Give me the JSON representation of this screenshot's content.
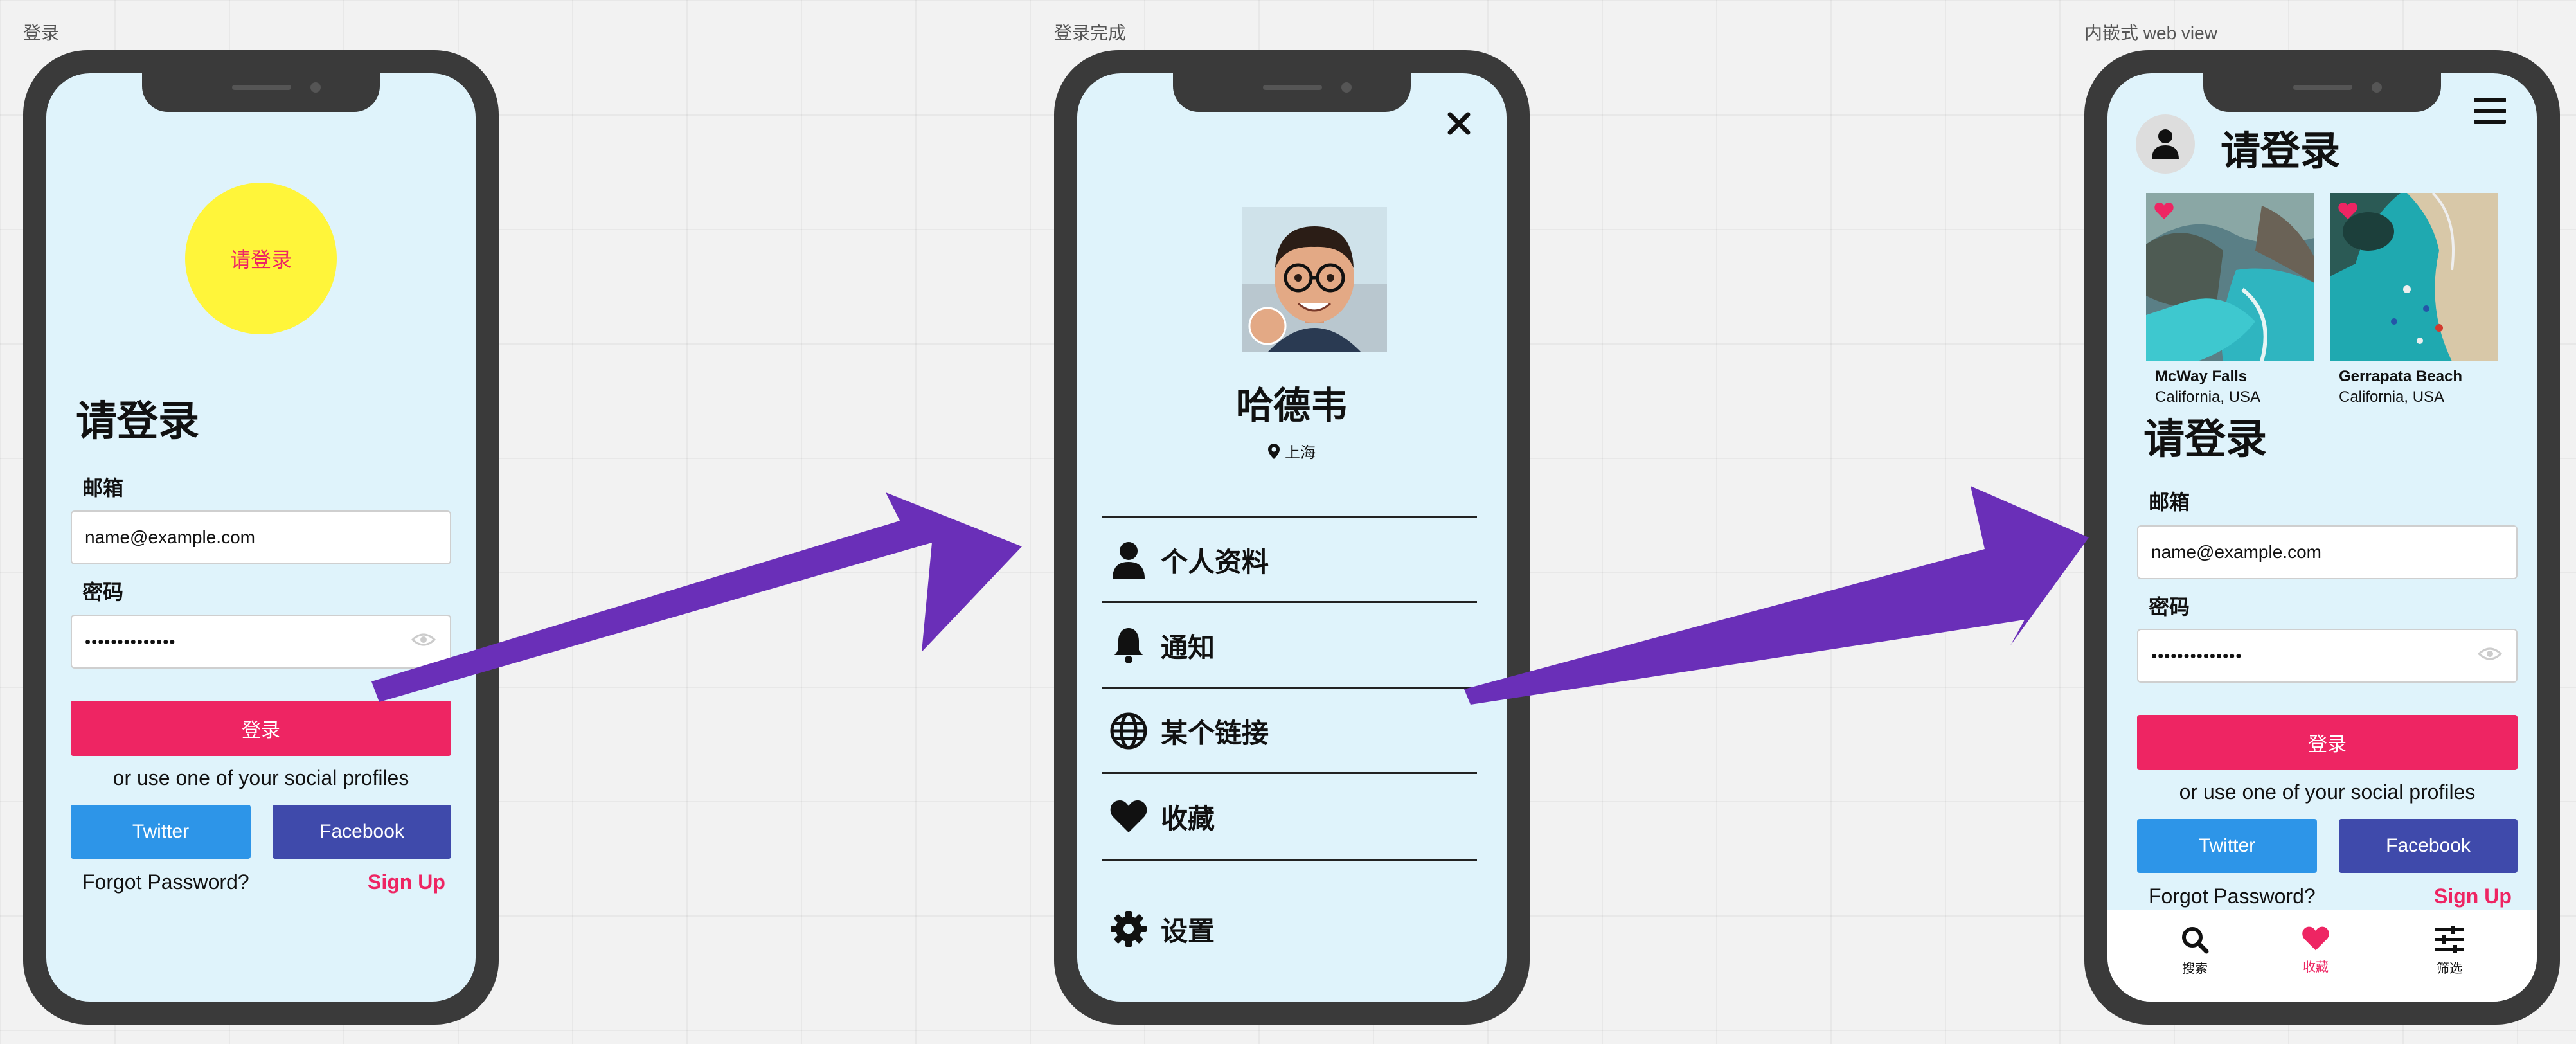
{
  "frames": [
    {
      "label": "登录"
    },
    {
      "label": "登录完成"
    },
    {
      "label": "内嵌式 web view"
    }
  ],
  "login": {
    "avatar_text": "请登录",
    "heading": "请登录",
    "email_label": "邮箱",
    "email_value": "name@example.com",
    "password_label": "密码",
    "password_value": "••••••••••••••",
    "login_button": "登录",
    "social_text": "or use one of your social profiles",
    "twitter": "Twitter",
    "facebook": "Facebook",
    "forgot": "Forgot Password?",
    "signup": "Sign Up"
  },
  "profile": {
    "name": "哈德韦",
    "location": "上海",
    "menu": [
      {
        "label": "个人资料",
        "icon": "user-icon"
      },
      {
        "label": "通知",
        "icon": "bell-icon"
      },
      {
        "label": "某个链接",
        "icon": "globe-icon"
      },
      {
        "label": "收藏",
        "icon": "heart-icon"
      }
    ],
    "settings": {
      "label": "设置",
      "icon": "gear-icon"
    }
  },
  "webview": {
    "title": "请登录",
    "cards": [
      {
        "title": "McWay Falls",
        "subtitle": "California, USA"
      },
      {
        "title": "Gerrapata Beach",
        "subtitle": "California, USA"
      }
    ],
    "heading": "请登录",
    "email_label": "邮箱",
    "email_value": "name@example.com",
    "password_label": "密码",
    "password_value": "••••••••••••••",
    "login_button": "登录",
    "social_text": "or use one of your social profiles",
    "twitter": "Twitter",
    "facebook": "Facebook",
    "forgot": "Forgot Password?",
    "signup": "Sign Up",
    "nav": [
      {
        "label": "搜索",
        "icon": "search-icon"
      },
      {
        "label": "收藏",
        "icon": "heart-icon"
      },
      {
        "label": "筛选",
        "icon": "filter-icon"
      }
    ]
  },
  "colors": {
    "accent": "#ee2563",
    "twitter": "#2d95e8",
    "facebook": "#3f4aab",
    "arrow": "#6a2fb8",
    "screen_bg": "#dff3fb",
    "avatar_circle": "#fff53a"
  }
}
